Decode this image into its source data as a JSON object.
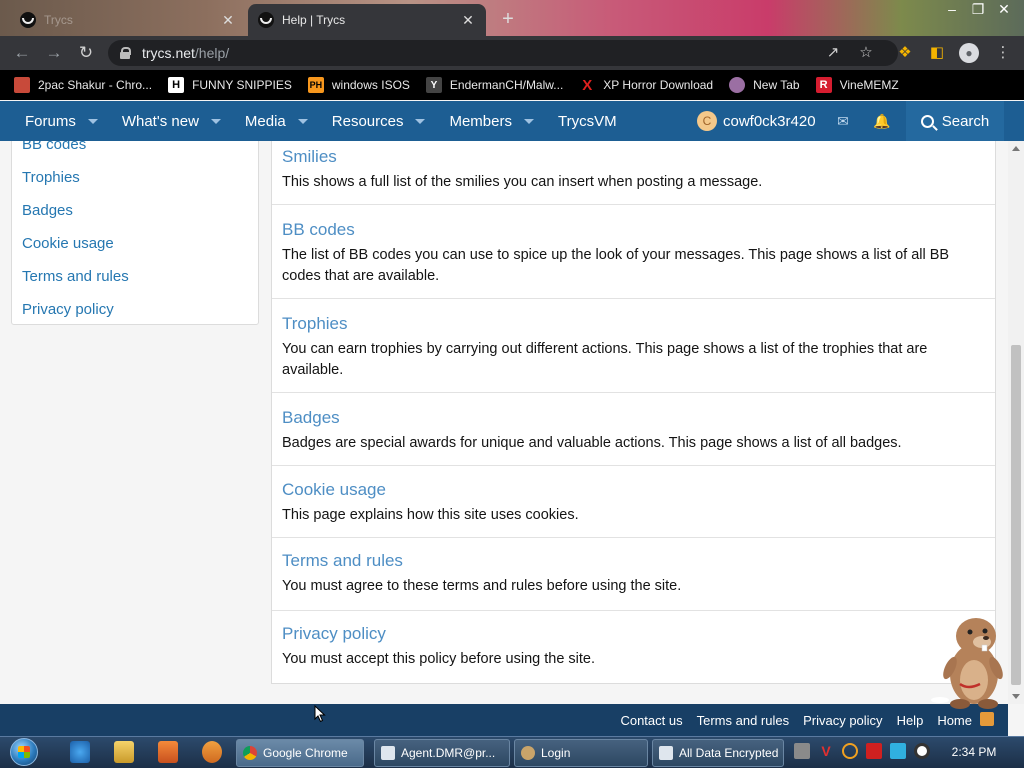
{
  "browser": {
    "tabs": [
      {
        "title": "Trycs",
        "active": false
      },
      {
        "title": "Help | Trycs",
        "active": true
      }
    ],
    "new_tab_glyph": "+",
    "close_glyph": "✕",
    "window_controls": {
      "minimize": "–",
      "restore": "❐",
      "close": "✕"
    },
    "address": {
      "host": "trycs.net",
      "path": "/help/"
    },
    "bookmarks": [
      {
        "label": "2pac Shakur - Chro...",
        "icon": "bookmark-2pac-icon",
        "color": "#c84a3a"
      },
      {
        "label": "FUNNY SNIPPIES",
        "icon": "h-logo-icon",
        "color": "#ffffff"
      },
      {
        "label": "windows ISOS",
        "icon": "ph-logo-icon",
        "color": "#f7971d"
      },
      {
        "label": "EndermanCH/Malw...",
        "icon": "ycombinator-icon",
        "color": "#444444"
      },
      {
        "label": "XP Horror Download",
        "icon": "x-logo-icon",
        "color": "#e0201e"
      },
      {
        "label": "New Tab",
        "icon": "globe-icon",
        "color": "#9b6fa3"
      },
      {
        "label": "VineMEMZ",
        "icon": "r-logo-icon",
        "color": "#d61d30"
      }
    ]
  },
  "site_nav": {
    "items": [
      {
        "label": "Forums",
        "dropdown": true
      },
      {
        "label": "What's new",
        "dropdown": true
      },
      {
        "label": "Media",
        "dropdown": true
      },
      {
        "label": "Resources",
        "dropdown": true
      },
      {
        "label": "Members",
        "dropdown": true
      },
      {
        "label": "TrycsVM",
        "dropdown": false
      }
    ],
    "user": {
      "avatar_letter": "C",
      "name": "cowf0ck3r420"
    },
    "search_label": "Search",
    "accent": "#1d5e93"
  },
  "sidebar": {
    "items": [
      "BB codes",
      "Trophies",
      "Badges",
      "Cookie usage",
      "Terms and rules",
      "Privacy policy"
    ]
  },
  "help_entries": [
    {
      "title": "Smilies",
      "desc": "This shows a full list of the smilies you can insert when posting a message."
    },
    {
      "title": "BB codes",
      "desc": "The list of BB codes you can use to spice up the look of your messages. This page shows a list of all BB codes that are available."
    },
    {
      "title": "Trophies",
      "desc": "You can earn trophies by carrying out different actions. This page shows a list of the trophies that are available."
    },
    {
      "title": "Badges",
      "desc": "Badges are special awards for unique and valuable actions. This page shows a list of all badges."
    },
    {
      "title": "Cookie usage",
      "desc": "This page explains how this site uses cookies."
    },
    {
      "title": "Terms and rules",
      "desc": "You must agree to these terms and rules before using the site."
    },
    {
      "title": "Privacy policy",
      "desc": "You must accept this policy before using the site."
    }
  ],
  "footer": {
    "links": [
      "Contact us",
      "Terms and rules",
      "Privacy policy",
      "Help",
      "Home"
    ]
  },
  "taskbar": {
    "buttons": [
      {
        "label": "Google Chrome",
        "active": true
      },
      {
        "label": "Agent.DMR@pr...",
        "active": false
      },
      {
        "label": "Login",
        "active": false
      },
      {
        "label": "All Data Encrypted",
        "active": false
      }
    ],
    "clock": "2:34 PM"
  }
}
